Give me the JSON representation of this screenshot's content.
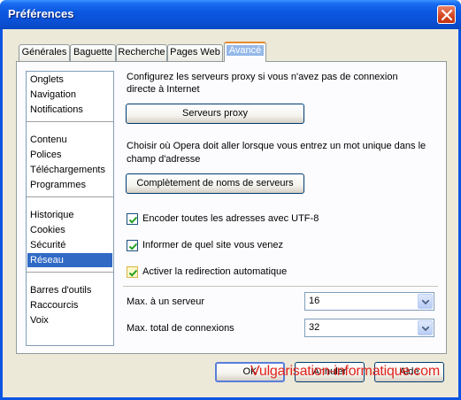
{
  "window": {
    "title": "Préférences",
    "accent": "#0a55e4"
  },
  "tabs": [
    {
      "label": "Générales"
    },
    {
      "label": "Baguette"
    },
    {
      "label": "Recherche"
    },
    {
      "label": "Pages Web"
    },
    {
      "label": "Avancé",
      "active": true
    }
  ],
  "nav": {
    "groups": [
      [
        "Onglets",
        "Navigation",
        "Notifications"
      ],
      [
        "Contenu",
        "Polices",
        "Téléchargements",
        "Programmes"
      ],
      [
        "Historique",
        "Cookies",
        "Sécurité",
        "Réseau"
      ],
      [
        "Barres d'outils",
        "Raccourcis",
        "Voix"
      ]
    ],
    "selected": "Réseau"
  },
  "network": {
    "proxy_text_1": "Configurez les serveurs proxy si vous n'avez pas de connexion",
    "proxy_text_2": "directe à Internet",
    "proxy_button": "Serveurs proxy",
    "completion_text_1": "Choisir où Opera doit aller lorsque vous entrez un mot unique dans le",
    "completion_text_2": "champ d'adresse",
    "completion_button": "Complètement de noms de serveurs",
    "checkboxes": [
      {
        "label": "Encoder toutes les adresses avec UTF-8",
        "checked": true
      },
      {
        "label": "Informer de quel site vous venez",
        "checked": true
      },
      {
        "label": "Activer la redirection automatique",
        "checked": true,
        "highlighted": true
      }
    ],
    "max_server_label": "Max. à un serveur",
    "max_server_value": "16",
    "max_total_label": "Max. total de connexions",
    "max_total_value": "32"
  },
  "footer": {
    "ok": "OK",
    "cancel": "Annuler",
    "help": "Aide",
    "watermark": "Vulgarisation-informatique.com"
  }
}
